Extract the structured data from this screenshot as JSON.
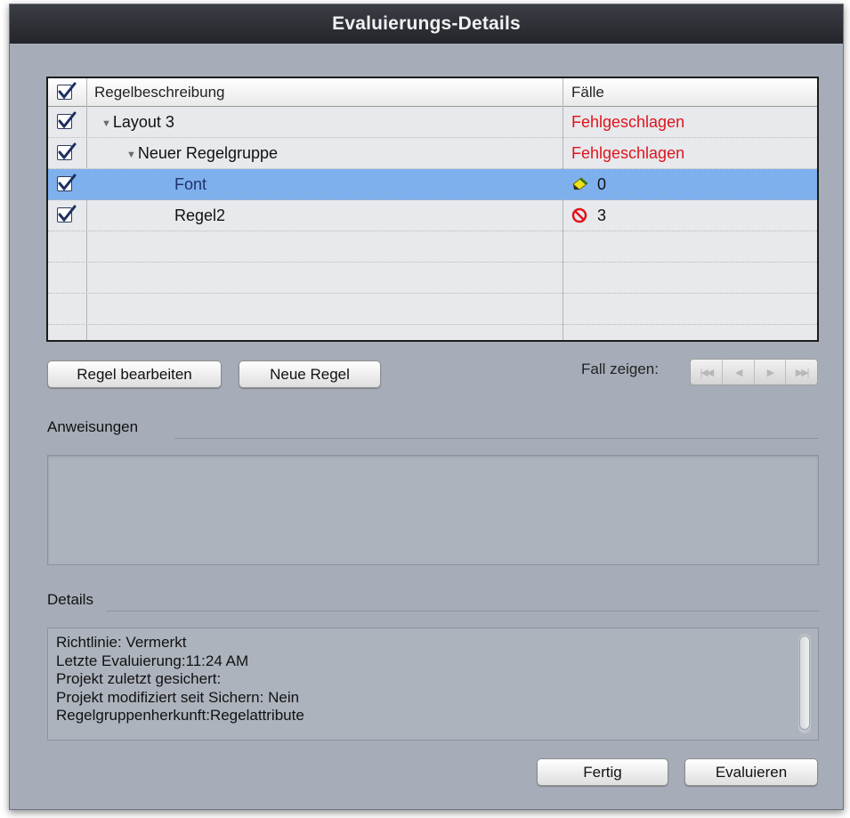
{
  "window": {
    "title": "Evaluierungs-Details"
  },
  "table": {
    "headers": {
      "description": "Regelbeschreibung",
      "cases": "Fälle"
    },
    "rows": [
      {
        "label": "Layout 3",
        "status": "Fehlgeschlagen",
        "checked": true,
        "expanded": true
      },
      {
        "label": "Neuer Regelgruppe",
        "status": "Fehlgeschlagen",
        "checked": true,
        "expanded": true
      },
      {
        "label": "Font",
        "count": "0",
        "icon": "pencil-warning-icon",
        "checked": true,
        "selected": true
      },
      {
        "label": "Regel2",
        "count": "3",
        "icon": "prohibited-icon",
        "checked": true
      }
    ]
  },
  "buttons": {
    "edit_rule": "Regel bearbeiten",
    "new_rule": "Neue Regel",
    "done": "Fertig",
    "evaluate": "Evaluieren"
  },
  "navigation": {
    "label": "Fall zeigen:"
  },
  "sections": {
    "instructions": "Anweisungen",
    "details": "Details"
  },
  "details": {
    "lines": [
      "Richtlinie: Vermerkt",
      "Letzte Evaluierung:11:24 AM",
      "Projekt zuletzt gesichert:",
      "Projekt modifiziert seit Sichern: Nein",
      "Regelgruppenherkunft:Regelattribute"
    ]
  },
  "colors": {
    "failed": "#e0141d",
    "selected_row": "#7fb0ee",
    "window_bg": "#a6adb8"
  }
}
